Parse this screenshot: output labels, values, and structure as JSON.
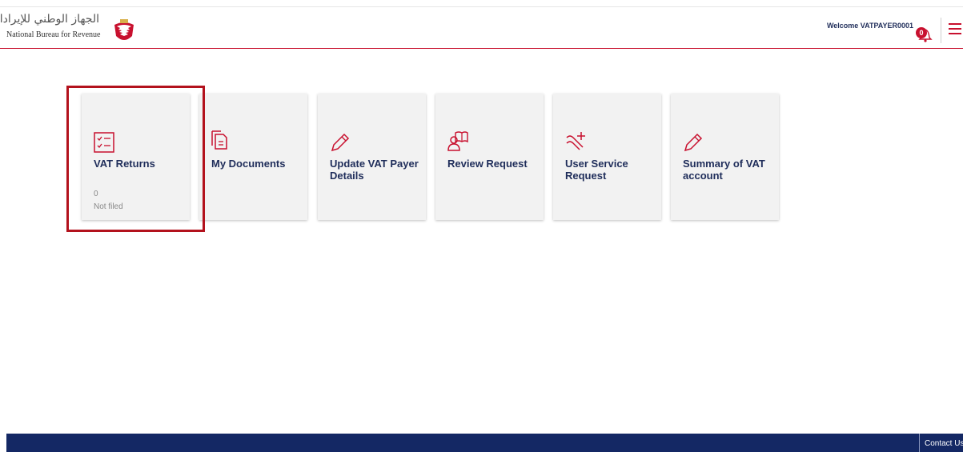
{
  "header": {
    "brand_arabic": "الجهاز الوطني للإيرادات",
    "brand_english": "National Bureau for Revenue",
    "welcome_text": "Welcome VATPAYER0001",
    "notification_count": "0"
  },
  "tiles": [
    {
      "title": "VAT Returns",
      "count": "0",
      "status": "Not filed",
      "icon": "checklist-icon"
    },
    {
      "title": "My Documents",
      "icon": "documents-icon"
    },
    {
      "title": "Update VAT Payer Details",
      "icon": "pencil-icon"
    },
    {
      "title": "Review Request",
      "icon": "person-book-icon"
    },
    {
      "title": "User Service Request",
      "icon": "tools-plus-icon"
    },
    {
      "title": "Summary of VAT account",
      "icon": "pencil-icon"
    }
  ],
  "footer": {
    "contact_label": "Contact Us"
  },
  "colors": {
    "accent_red": "#c8102e",
    "navy": "#1f2d5a",
    "footer_bg": "#142864",
    "tile_bg": "#f2f2f2"
  }
}
